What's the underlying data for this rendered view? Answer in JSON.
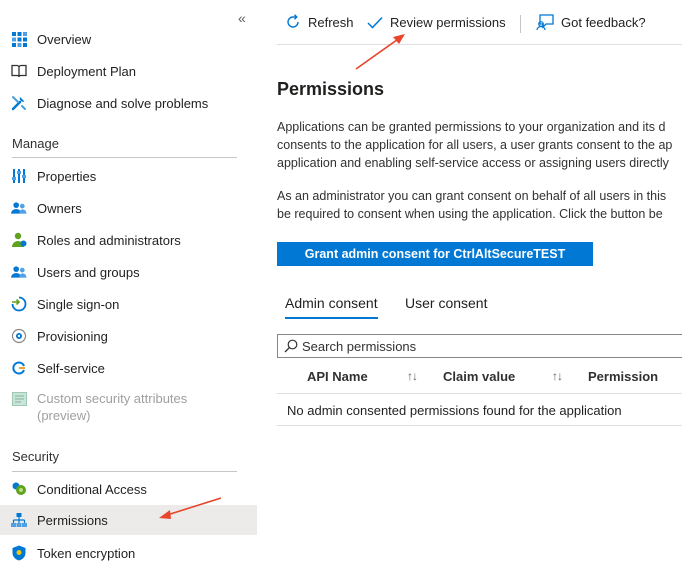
{
  "sidebar": {
    "items_top": [
      {
        "label": "Overview",
        "icon": "grid-icon"
      },
      {
        "label": "Deployment Plan",
        "icon": "book-icon"
      },
      {
        "label": "Diagnose and solve problems",
        "icon": "wrench-icon"
      }
    ],
    "manage_heading": "Manage",
    "manage_items": [
      {
        "label": "Properties",
        "icon": "sliders-icon"
      },
      {
        "label": "Owners",
        "icon": "people-icon"
      },
      {
        "label": "Roles and administrators",
        "icon": "person-icon"
      },
      {
        "label": "Users and groups",
        "icon": "people-icon"
      },
      {
        "label": "Single sign-on",
        "icon": "sso-icon"
      },
      {
        "label": "Provisioning",
        "icon": "provisioning-icon"
      },
      {
        "label": "Self-service",
        "icon": "self-service-icon"
      },
      {
        "label": "Custom security attributes",
        "label2": "(preview)",
        "icon": "attributes-icon"
      }
    ],
    "security_heading": "Security",
    "security_items": [
      {
        "label": "Conditional Access",
        "icon": "conditional-access-icon"
      },
      {
        "label": "Permissions",
        "icon": "hierarchy-icon"
      },
      {
        "label": "Token encryption",
        "icon": "shield-icon"
      }
    ]
  },
  "toolbar": {
    "refresh": "Refresh",
    "review": "Review permissions",
    "feedback": "Got feedback?"
  },
  "main": {
    "title": "Permissions",
    "para1": [
      "Applications can be granted permissions to your organization and its d",
      "consents to the application for all users, a user grants consent to the ap",
      "application and enabling self-service access or assigning users directly"
    ],
    "para2": [
      "As an administrator you can grant consent on behalf of all users in this",
      "be required to consent when using the application. Click the button be"
    ],
    "grant_button": "Grant admin consent for CtrlAltSecureTEST",
    "tabs": [
      "Admin consent",
      "User consent"
    ],
    "search_placeholder": "Search permissions",
    "columns": [
      "API Name",
      "Claim value",
      "Permission"
    ],
    "empty_message": "No admin consented permissions found for the application"
  },
  "colors": {
    "accent": "#0078d4",
    "annotation_arrow": "#e8452c",
    "selected_bg": "#edebe9"
  }
}
